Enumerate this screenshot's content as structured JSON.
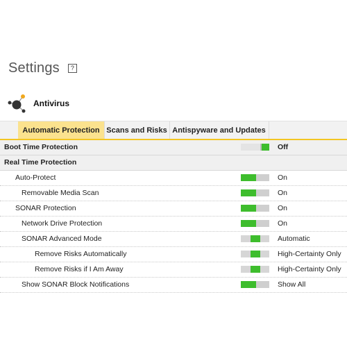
{
  "page": {
    "title": "Settings",
    "help_icon_text": "?"
  },
  "section": {
    "title": "Antivirus",
    "icon": "antivirus-molecule-icon"
  },
  "tabs": [
    {
      "label": "Automatic Protection",
      "active": true
    },
    {
      "label": "Scans and Risks",
      "active": false
    },
    {
      "label": "Antispyware and Updates",
      "active": false
    }
  ],
  "rows": [
    {
      "label": "Boot Time Protection",
      "status": "Off",
      "toggle": "off",
      "group": true
    },
    {
      "label": "Real Time Protection",
      "group": true
    },
    {
      "label": "Auto-Protect",
      "status": "On",
      "toggle": "on"
    },
    {
      "label": "Removable Media Scan",
      "status": "On",
      "toggle": "on"
    },
    {
      "label": "SONAR Protection",
      "status": "On",
      "toggle": "on"
    },
    {
      "label": "Network Drive Protection",
      "status": "On",
      "toggle": "on"
    },
    {
      "label": "SONAR Advanced Mode",
      "status": "Automatic",
      "toggle": "mid"
    },
    {
      "label": "Remove Risks Automatically",
      "status": "High-Certainty Only",
      "toggle": "mid"
    },
    {
      "label": "Remove Risks if I Am Away",
      "status": "High-Certainty Only",
      "toggle": "mid"
    },
    {
      "label": "Show SONAR Block Notifications",
      "status": "Show All",
      "toggle": "on"
    }
  ],
  "colors": {
    "accent": "#f3c623",
    "active_tab": "#fbe28e",
    "toggle_on": "#3ebd2d"
  }
}
